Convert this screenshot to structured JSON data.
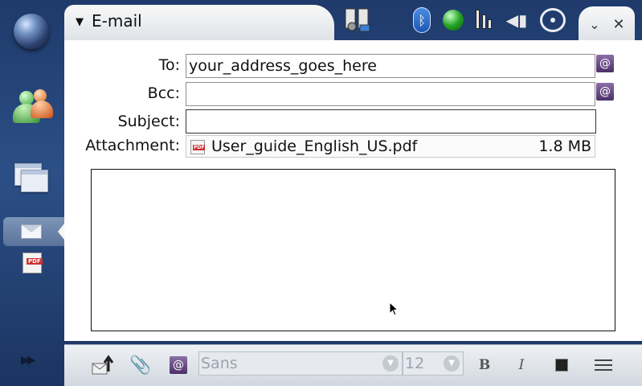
{
  "window": {
    "title": "E-mail",
    "collapse_indicator": "▼"
  },
  "form": {
    "to_label": "To:",
    "to_value": "your_address_goes_here",
    "bcc_label": "Bcc:",
    "bcc_value": "",
    "subject_label": "Subject:",
    "subject_value": "",
    "attachment_label": "Attachment:",
    "attachment_name": "User_guide_English_US.pdf",
    "attachment_size": "1.8 MB",
    "address_book_glyph": "@"
  },
  "toolbar": {
    "font_value": "Sans",
    "size_value": "12",
    "bold_label": "B",
    "italic_label": "I"
  },
  "status_icons": [
    "connectivity-icon",
    "bluetooth-icon",
    "presence-icon",
    "battery-icon",
    "volume-icon",
    "internet-connection-icon"
  ],
  "launcher_icons": [
    "web-browser-icon",
    "contacts-icon",
    "applications-icon",
    "email-icon",
    "pdf-document-icon",
    "next-arrows-icon"
  ],
  "colors": {
    "background": "#2b4f86",
    "presence": "#25a425",
    "bluetooth": "#1a55b3"
  }
}
